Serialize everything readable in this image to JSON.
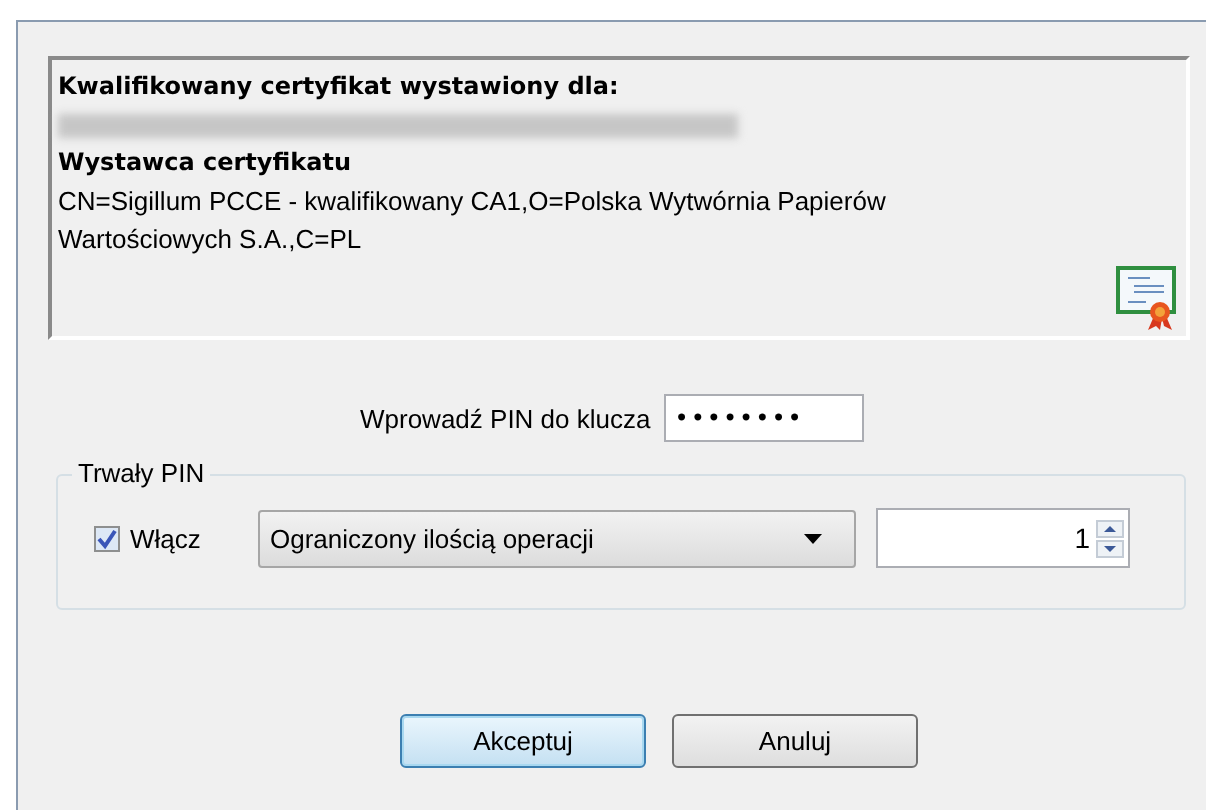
{
  "certificate": {
    "subject_heading": "Kwalifikowany certyfikat wystawiony dla:",
    "issuer_heading": "Wystawca certyfikatu",
    "issuer": "CN=Sigillum PCCE - kwalifikowany CA1,O=Polska Wytwórnia Papierów Wartościowych S.A.,C=PL"
  },
  "pin": {
    "label": "Wprowadź PIN do klucza",
    "value": "••••••••"
  },
  "persistent_pin": {
    "legend": "Trwały PIN",
    "enable_label": "Włącz",
    "checked": true,
    "mode": "Ograniczony ilością operacji",
    "count": "1"
  },
  "buttons": [
    {
      "label": "Akceptuj",
      "default": true
    },
    {
      "label": "Anuluj",
      "default": false
    }
  ]
}
